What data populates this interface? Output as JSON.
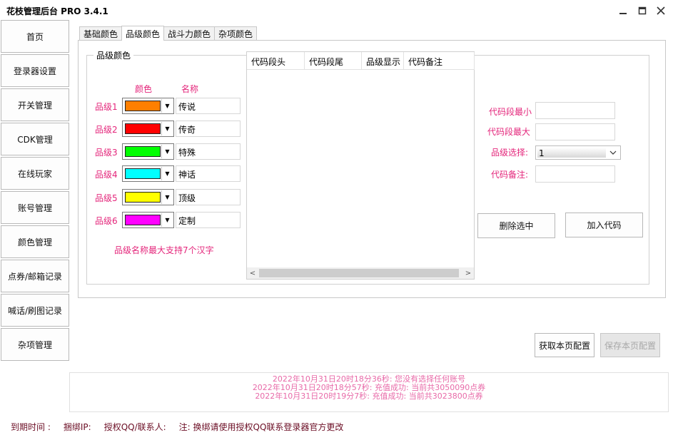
{
  "window": {
    "title": "花枝管理后台 PRO 3.4.1"
  },
  "sidebar": {
    "items": [
      {
        "label": "首页"
      },
      {
        "label": "登录器设置"
      },
      {
        "label": "开关管理"
      },
      {
        "label": "CDK管理"
      },
      {
        "label": "在线玩家"
      },
      {
        "label": "账号管理"
      },
      {
        "label": "颜色管理"
      },
      {
        "label": "点券/邮箱记录"
      },
      {
        "label": "喊话/刷图记录"
      },
      {
        "label": "杂项管理"
      }
    ]
  },
  "tabs": [
    {
      "label": "基础颜色"
    },
    {
      "label": "品级颜色",
      "active": true
    },
    {
      "label": "战斗力颜色"
    },
    {
      "label": "杂项颜色"
    }
  ],
  "grade_panel": {
    "group_title": "品级颜色",
    "col_color": "颜色",
    "col_name": "名称",
    "grades": [
      {
        "label": "品级1",
        "color": "#ff7f00",
        "name": "传说"
      },
      {
        "label": "品级2",
        "color": "#ff0000",
        "name": "传奇"
      },
      {
        "label": "品级3",
        "color": "#00ff00",
        "name": "特殊"
      },
      {
        "label": "品级4",
        "color": "#00ffff",
        "name": "神话"
      },
      {
        "label": "品级5",
        "color": "#ffff00",
        "name": "顶级"
      },
      {
        "label": "品级6",
        "color": "#ff00ff",
        "name": "定制"
      }
    ],
    "hint": "品级名称最大支持7个汉字"
  },
  "code_list": {
    "columns": [
      "代码段头",
      "代码段尾",
      "品级显示",
      "代码备注"
    ]
  },
  "code_form": {
    "min_label": "代码段最小",
    "max_label": "代码段最大",
    "grade_label": "品级选择:",
    "grade_value": "1",
    "note_label": "代码备注:",
    "delete_button": "删除选中",
    "add_button": "加入代码"
  },
  "actions": {
    "fetch_button": "获取本页配置",
    "save_button": "保存本页配置"
  },
  "log": [
    "2022年10月31日20时18分36秒: 您没有选择任何账号",
    "2022年10月31日20时18分57秒: 充值成功: 当前共3050090点券",
    "2022年10月31日20时19分7秒: 充值成功: 当前共3023800点券"
  ],
  "status": {
    "expire": "到期时间 :",
    "bind_ip": "捆绑IP:",
    "auth": "授权QQ/联系人:",
    "note": "注: 换绑请使用授权QQ联系登录器官方更改"
  }
}
